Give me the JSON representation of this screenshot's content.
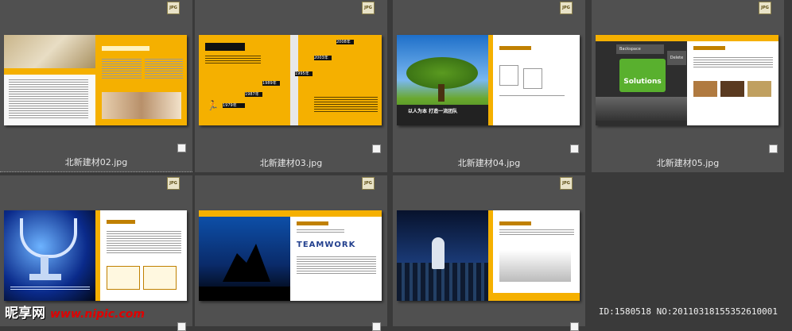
{
  "badge_label": "JPG",
  "cells": [
    {
      "caption": "北新建材02.jpg",
      "selected": true
    },
    {
      "caption": "北新建材03.jpg"
    },
    {
      "caption": "北新建材04.jpg"
    },
    {
      "caption": "北新建材05.jpg"
    },
    {
      "caption": ""
    },
    {
      "caption": ""
    },
    {
      "caption": ""
    }
  ],
  "thumb_texts": {
    "t3_years": [
      "1979年",
      "1987年",
      "1989年",
      "1995年",
      "2003年",
      "2008年"
    ],
    "t4_slogan": "以人为本 打造一流团队",
    "t5_key": "Solutions",
    "t5_key_top": "Backspace",
    "t5_key_delete": "Delete",
    "t6_work": "TEAMWORK"
  },
  "watermark": {
    "logo": "昵享网",
    "url": "www.nipic.com"
  },
  "footer_id": "ID:1580518 NO:20110318155352610001",
  "colors": {
    "accent_yellow": "#f5b000",
    "cell_bg": "#505050",
    "bg": "#3a3a3a"
  }
}
